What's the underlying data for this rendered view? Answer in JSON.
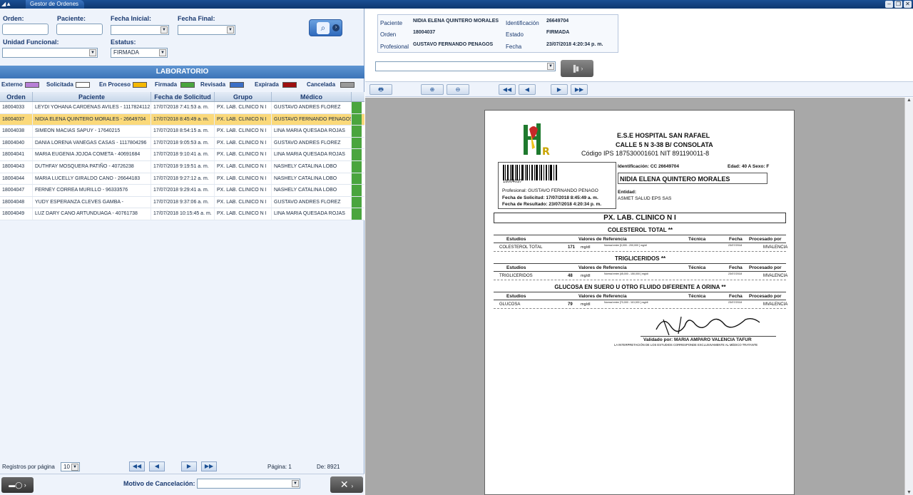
{
  "window": {
    "tab_title": "Gestor de Ordenes"
  },
  "filters": {
    "orden_label": "Orden:",
    "orden_value": "",
    "paciente_label": "Paciente:",
    "paciente_value": "",
    "fecha_inicial_label": "Fecha Inicial:",
    "fecha_inicial_value": "",
    "fecha_final_label": "Fecha Final:",
    "fecha_final_value": "",
    "unidad_label": "Unidad Funcional:",
    "unidad_value": "",
    "estatus_label": "Estatus:",
    "estatus_value": "FIRMADA"
  },
  "section_title": "LABORATORIO",
  "legend": [
    {
      "label": "Externo",
      "color": "#b77fd6"
    },
    {
      "label": "Solicitada",
      "color": "#ffffff"
    },
    {
      "label": "En Proceso",
      "color": "#f5b800"
    },
    {
      "label": "Firmada",
      "color": "#4aa53e"
    },
    {
      "label": "Revisada",
      "color": "#3b6fc6"
    },
    {
      "label": "Expirada",
      "color": "#9e1010"
    },
    {
      "label": "Cancelada",
      "color": "#9a9a9a"
    }
  ],
  "grid": {
    "headers": [
      "Orden",
      "Paciente",
      "Fecha de Solicitud",
      "Grupo",
      "Médico"
    ],
    "selected_index": 1,
    "rows": [
      {
        "orden": "18004033",
        "paciente": "LEYDI YOHANA CARDENAS AVILES - 1117824112",
        "fecha": "17/07/2018 7:41:53 a. m.",
        "grupo": "PX. LAB. CLINICO N I",
        "medico": "GUSTAVO ANDRES FLOREZ"
      },
      {
        "orden": "18004037",
        "paciente": "NIDIA ELENA QUINTERO MORALES - 26649704",
        "fecha": "17/07/2018 8:45:49 a. m.",
        "grupo": "PX. LAB. CLINICO N I",
        "medico": "GUSTAVO FERNANDO PENAGOS"
      },
      {
        "orden": "18004038",
        "paciente": "SIMEON  MACIAS SAPUY - 17640215",
        "fecha": "17/07/2018 8:54:15 a. m.",
        "grupo": "PX. LAB. CLINICO N I",
        "medico": "LINA MARIA QUESADA ROJAS"
      },
      {
        "orden": "18004040",
        "paciente": "DANIA LORENA VANEGAS CASAS - 1117804296",
        "fecha": "17/07/2018 9:05:53 a. m.",
        "grupo": "PX. LAB. CLINICO N I",
        "medico": "GUSTAVO ANDRES FLOREZ"
      },
      {
        "orden": "18004041",
        "paciente": "MARIA EUGENIA JOJOA COMETA - 40691684",
        "fecha": "17/07/2018 9:10:41 a. m.",
        "grupo": "PX. LAB. CLINICO N I",
        "medico": "LINA MARIA QUESADA ROJAS"
      },
      {
        "orden": "18004043",
        "paciente": "DUTHFAY  MOSQUERA PATIÑO - 40726238",
        "fecha": "17/07/2018 9:19:51 a. m.",
        "grupo": "PX. LAB. CLINICO N I",
        "medico": "NASHELY CATALINA LOBO"
      },
      {
        "orden": "18004044",
        "paciente": "MARIA  LUCELLY GIRALDO CANO - 26644183",
        "fecha": "17/07/2018 9:27:12 a. m.",
        "grupo": "PX. LAB. CLINICO N I",
        "medico": "NASHELY CATALINA LOBO"
      },
      {
        "orden": "18004047",
        "paciente": "FERNEY  CORREA MURILLO - 96333576",
        "fecha": "17/07/2018 9:29:41 a. m.",
        "grupo": "PX. LAB. CLINICO N I",
        "medico": "NASHELY CATALINA LOBO"
      },
      {
        "orden": "18004048",
        "paciente": "YUDY ESPERANZA CLEVES GAMBA -",
        "fecha": "17/07/2018 9:37:06 a. m.",
        "grupo": "PX. LAB. CLINICO N I",
        "medico": "GUSTAVO ANDRES FLOREZ"
      },
      {
        "orden": "18004049",
        "paciente": "LUZ  DARY CANO ARTUNDUAGA - 40761738",
        "fecha": "17/07/2018 10:15:45 a. m.",
        "grupo": "PX. LAB. CLINICO N I",
        "medico": "LINA MARIA QUESADA ROJAS"
      }
    ]
  },
  "pager": {
    "per_page_label": "Registros por página",
    "per_page_value": "10",
    "page_label": "Página: 1",
    "of_label": "De: 8921"
  },
  "cancel": {
    "label": "Motivo de Cancelación:",
    "value": ""
  },
  "detail": {
    "paciente_k": "Paciente",
    "paciente_v": "NIDIA ELENA QUINTERO MORALES",
    "identificacion_k": "Identificación",
    "identificacion_v": "26649704",
    "orden_k": "Orden",
    "orden_v": "18004037",
    "estado_k": "Estado",
    "estado_v": "FIRMADA",
    "profesional_k": "Profesional",
    "profesional_v": "GUSTAVO FERNANDO PENAGOS",
    "fecha_k": "Fecha",
    "fecha_v": "23/07/2018 4:20:34 p. m."
  },
  "report": {
    "hospital": "E.S.E HOSPITAL SAN RAFAEL",
    "address": "CALLE 5 N 3-38 B/ CONSOLATA",
    "codigo": "Código IPS  187530001601    NIT  891190011-8",
    "barcode_num": "18004037",
    "profesional": "Profesional:  GUSTAVO FERNANDO PENAGO",
    "fecha_solicitud": "Fecha de Solicitud:  17/07/2018 8:45:49 a. m.",
    "fecha_resultado": "Fecha de Resultado: 23/07/2018 4:20:34 p. m.",
    "identificacion": "Identificación:  CC  26649704",
    "edad": "Edad: 40  A   Sexo:  F",
    "patient_name": "NIDIA ELENA QUINTERO MORALES",
    "entidad_label": "Entidad:",
    "entidad": "ASMET SALUD EPS SAS",
    "group": "PX. LAB. CLINICO N I",
    "col_estudios": "Estudios",
    "col_ref": "Valores de Referencia",
    "col_tecnica": "Técnica",
    "col_fecha": "Fecha",
    "col_proc": "Procesado por",
    "sections": [
      {
        "title": "COLESTEROL TOTAL **",
        "study": "COLESTEROL TOTAL",
        "value": "171",
        "unit": "mg/dl",
        "ref": "Normal entre [0,000 - 200,000 ] mg/dl",
        "date": "23/07/2018",
        "by": "MVALENCIA"
      },
      {
        "title": "TRIGLICERIDOS **",
        "study": "TRIGLICERIDOS",
        "value": "48",
        "unit": "mg/dl",
        "ref": "Normal entre [45,000 - 150,000 ] mg/dl",
        "date": "23/07/2018",
        "by": "MVALENCIA"
      },
      {
        "title": "GLUCOSA EN SUERO U OTRO FLUIDO DIFERENTE A ORINA **",
        "study": "GLUCOSA",
        "value": "79",
        "unit": "mg/dl",
        "ref": "Normal entre [70,000 - 110,000 ] mg/dl",
        "date": "23/07/2018",
        "by": "MVALENCIA"
      }
    ],
    "validado": "Validado por: MARIA AMPARO VALENCIA TAFUR",
    "disclaimer": "LA INTERPRETACIÓN DE LOS ESTUDIOS CORRESPONDE EXCLUSIVAMENTE AL MÉDICO TRATANTE"
  }
}
